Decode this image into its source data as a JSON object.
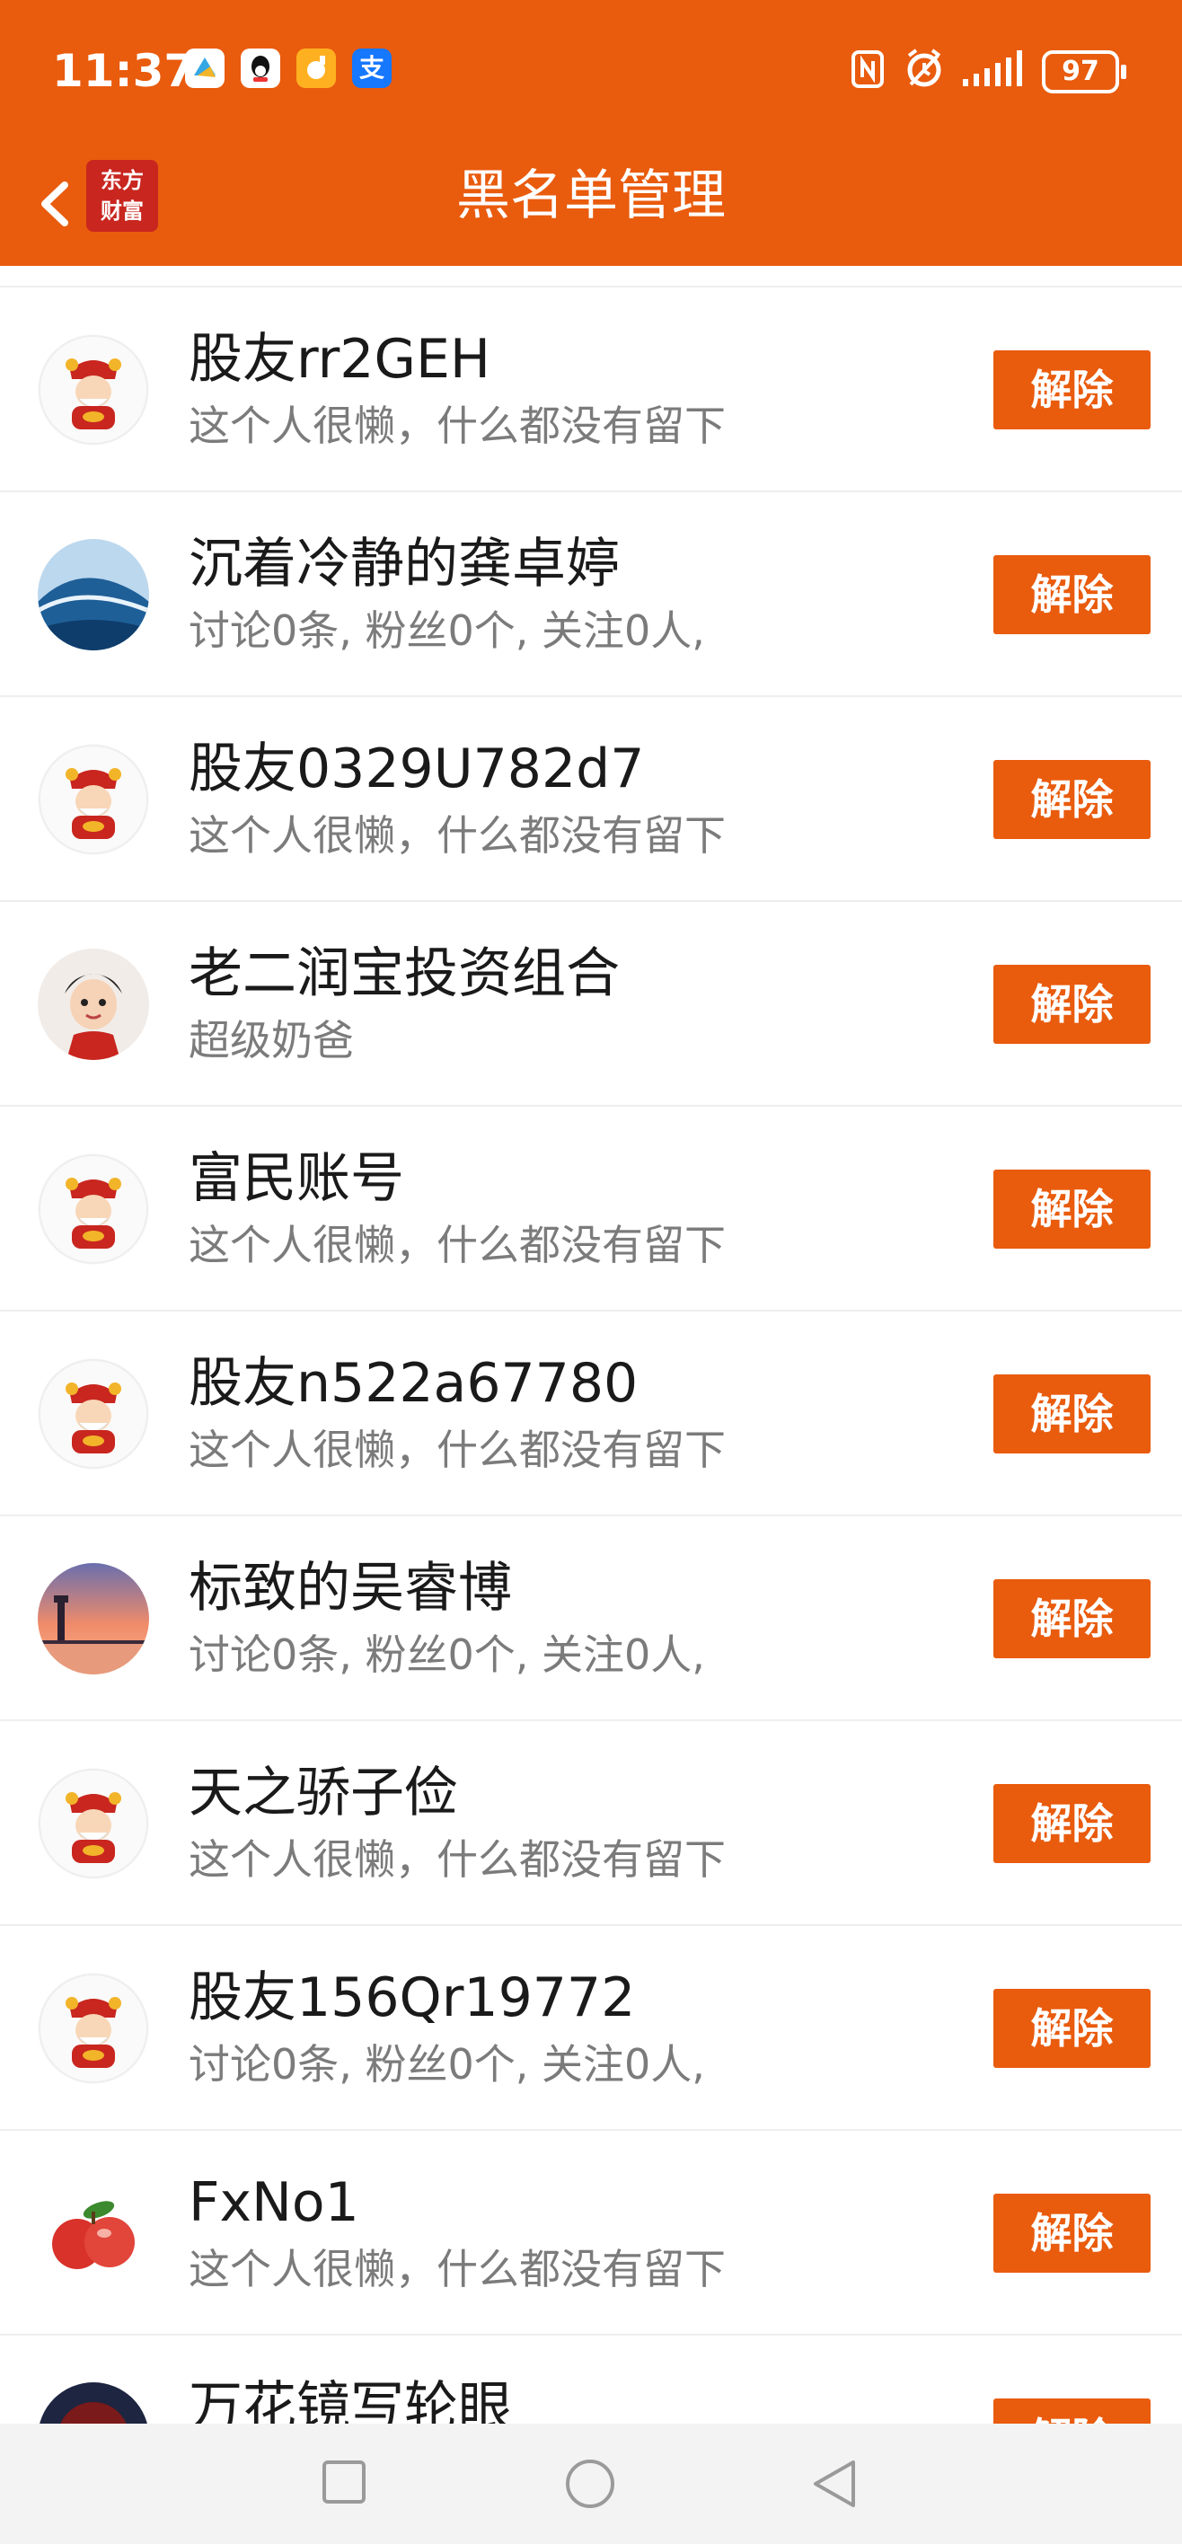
{
  "status_bar": {
    "time": "11:37",
    "battery": "97",
    "app_icons": [
      "app-icon-1",
      "qq-icon",
      "app-icon-3",
      "alipay-icon"
    ],
    "alipay_glyph": "支"
  },
  "header": {
    "title": "黑名单管理",
    "logo_line1": "东方",
    "logo_line2": "财富"
  },
  "colors": {
    "brand": "#e95b0d",
    "name_text": "#1a1a1a",
    "desc_text": "#7b7b7b"
  },
  "button_label": "解除",
  "users": [
    {
      "name": "股友rr2GEH",
      "desc": "这个人很懒，什么都没有留下",
      "avatar": "caishen"
    },
    {
      "name": "沉着冷静的龚卓婷",
      "desc": "讨论0条, 粉丝0个, 关注0人,",
      "avatar": "wave"
    },
    {
      "name": "股友0329U782d7",
      "desc": "这个人很懒，什么都没有留下",
      "avatar": "caishen"
    },
    {
      "name": "老二润宝投资组合",
      "desc": "超级奶爸",
      "avatar": "boy"
    },
    {
      "name": "富民账号",
      "desc": "这个人很懒，什么都没有留下",
      "avatar": "caishen"
    },
    {
      "name": "股友n522a67780",
      "desc": "这个人很懒，什么都没有留下",
      "avatar": "caishen"
    },
    {
      "name": "标致的吴睿博",
      "desc": "讨论0条, 粉丝0个, 关注0人,",
      "avatar": "sunset"
    },
    {
      "name": "天之骄子俭",
      "desc": "这个人很懒，什么都没有留下",
      "avatar": "caishen"
    },
    {
      "name": "股友156Qr19772",
      "desc": "讨论0条, 粉丝0个, 关注0人,",
      "avatar": "caishen"
    },
    {
      "name": "FxNo1",
      "desc": "这个人很懒，什么都没有留下",
      "avatar": "apple"
    },
    {
      "name": "万花镜写轮眼",
      "desc": "",
      "avatar": "dark"
    }
  ]
}
